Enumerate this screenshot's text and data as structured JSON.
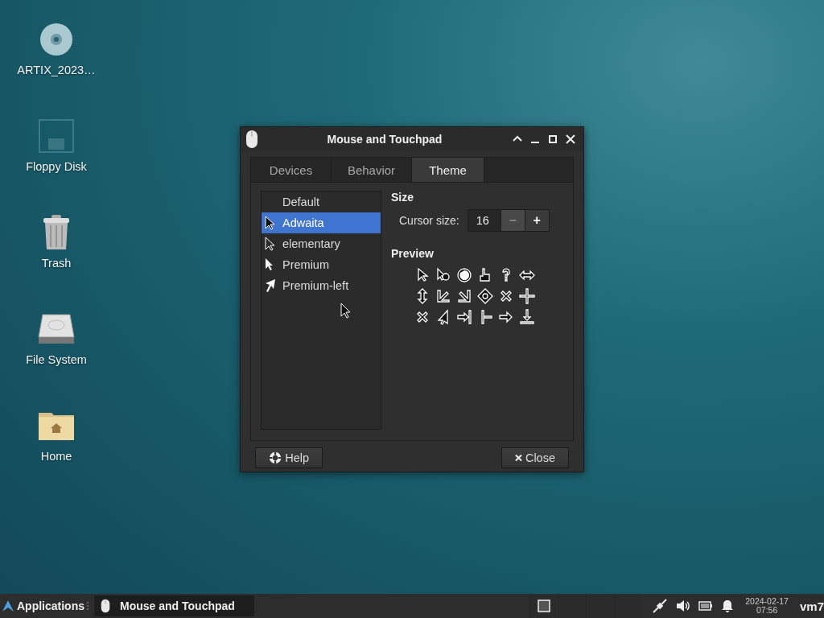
{
  "desktop_icons": [
    {
      "label": "ARTIX_2023…",
      "kind": "disc"
    },
    {
      "label": "Floppy Disk",
      "kind": "floppy"
    },
    {
      "label": "Trash",
      "kind": "trash"
    },
    {
      "label": "File System",
      "kind": "drive"
    },
    {
      "label": "Home",
      "kind": "folder"
    }
  ],
  "window": {
    "title": "Mouse and Touchpad",
    "tabs": [
      {
        "label": "Devices",
        "selected": false
      },
      {
        "label": "Behavior",
        "selected": false
      },
      {
        "label": "Theme",
        "selected": true
      }
    ],
    "theme_list": [
      {
        "label": "Default",
        "selected": false,
        "kind": "none"
      },
      {
        "label": "Adwaita",
        "selected": true,
        "kind": "black"
      },
      {
        "label": "elementary",
        "selected": false,
        "kind": "outline"
      },
      {
        "label": "Premium",
        "selected": false,
        "kind": "white"
      },
      {
        "label": "Premium-left",
        "selected": false,
        "kind": "left"
      }
    ],
    "size": {
      "heading": "Size",
      "label": "Cursor size:",
      "value": "16",
      "buttons": [
        {
          "label": "−",
          "disabled": true
        },
        {
          "label": "+",
          "disabled": false
        }
      ]
    },
    "preview": {
      "heading": "Preview"
    },
    "buttons": [
      {
        "label": "Help",
        "kind": "help"
      },
      {
        "label": "Close",
        "kind": "close"
      }
    ]
  },
  "taskbar": {
    "menu_label": "Applications",
    "tasks": [
      {
        "label": "Mouse and Touchpad",
        "selected": true
      }
    ],
    "date": "2024-02-17",
    "time": "07:56",
    "user": "vm7"
  }
}
